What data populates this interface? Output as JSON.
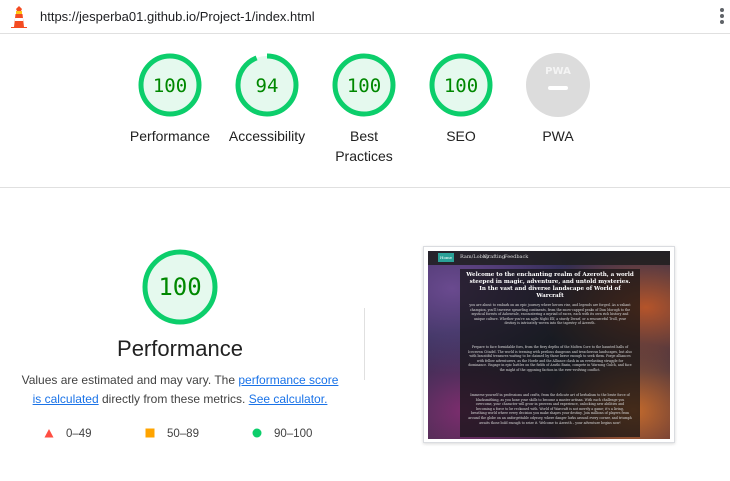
{
  "browser": {
    "url": "https://jesperba01.github.io/Project-1/index.html",
    "logo_icon": "lighthouse-icon",
    "menu_icon": "kebab-menu-icon"
  },
  "scores": [
    {
      "label": "Performance",
      "value": "100",
      "score": 1.0,
      "color": "#0cce6b"
    },
    {
      "label": "Accessibility",
      "value": "94",
      "score": 0.94,
      "color": "#0cce6b"
    },
    {
      "label": "Best Practices",
      "value": "100",
      "score": 1.0,
      "color": "#0cce6b"
    },
    {
      "label": "SEO",
      "value": "100",
      "score": 1.0,
      "color": "#0cce6b"
    },
    {
      "label": "PWA",
      "value": "PWA",
      "score": null,
      "color": "#cccccc"
    }
  ],
  "main": {
    "score": "100",
    "title": "Performance",
    "desc_prefix": "Values are estimated and may vary. The ",
    "link_perf": "performance score is calculated",
    "desc_mid": " directly from these metrics. ",
    "link_calc": "See calculator.",
    "legend": [
      {
        "range": "0–49",
        "shape": "triangle",
        "color": "#ff4e42"
      },
      {
        "range": "50–89",
        "shape": "square",
        "color": "#ffa400"
      },
      {
        "range": "90–100",
        "shape": "circle",
        "color": "#0cce6b"
      }
    ]
  },
  "screenshot": {
    "nav": [
      "Home",
      "Ram/Lobby",
      "Crafting",
      "Feedback"
    ],
    "heading": "Welcome to the enchanting realm of Azeroth, a world steeped in magic, adventure, and untold mysteries. In the vast and diverse landscape of World of Warcraft",
    "p1": "you are about to embark on an epic journey where heroes rise, and legends are forged. As a valiant champion, you'll traverse sprawling continents, from the snow-capped peaks of Dun Morogh to the mystical forests of Ashenvale, encountering a myriad of races, each with its own rich history and unique culture. Whether you're an agile Night Elf, a sturdy Dwarf, or a resourceful Troll, your destiny is intricately woven into the tapestry of Azeroth.",
    "p2": "Prepare to face formidable foes, from the fiery depths of the Molten Core to the haunted halls of Icecrown Citadel. The world is teeming with perilous dungeons and treacherous landscapes, but also with bountiful treasures waiting to be claimed by those brave enough to seek them. Forge alliances with fellow adventurers, as the Horde and the Alliance clash in an everlasting struggle for dominance. Engage in epic battles on the fields of Arathi Basin, compete in Warsong Gulch, and face the might of the opposing faction in the ever-evolving conflict.",
    "p3": "Immerse yourself in professions and crafts, from the delicate art of herbalism to the brute force of blacksmithing, as you hone your skills to become a master artisan. With each challenge you overcome, your character will grow in prowess and experience, unlocking new abilities and becoming a force to be reckoned with. World of Warcraft is not merely a game; it's a living, breathing world where every decision you make shapes your destiny. Join millions of players from around the globe on an unforgettable odyssey, where danger lurks around every corner, and triumph awaits those bold enough to seize it. Welcome to Azeroth – your adventure begins now!"
  }
}
